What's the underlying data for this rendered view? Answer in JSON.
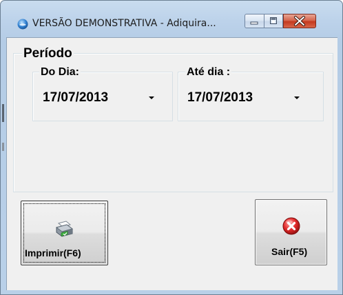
{
  "window": {
    "title": "VERSÃO DEMONSTRATIVA - Adiquira...",
    "icon": "app-globe-icon"
  },
  "periodo": {
    "label": "Período",
    "from": {
      "label": "Do Dia:",
      "value": "17/07/2013"
    },
    "to": {
      "label": "Até dia :",
      "value": "17/07/2013"
    }
  },
  "buttons": {
    "print": {
      "label": "Imprimir(F6)",
      "icon": "printer-icon"
    },
    "exit": {
      "label": "Sair(F5)",
      "icon": "exit-icon"
    }
  },
  "colors": {
    "frame": "#b9d0e8",
    "close_button": "#c4391e",
    "client_bg": "#f0f0f0"
  }
}
